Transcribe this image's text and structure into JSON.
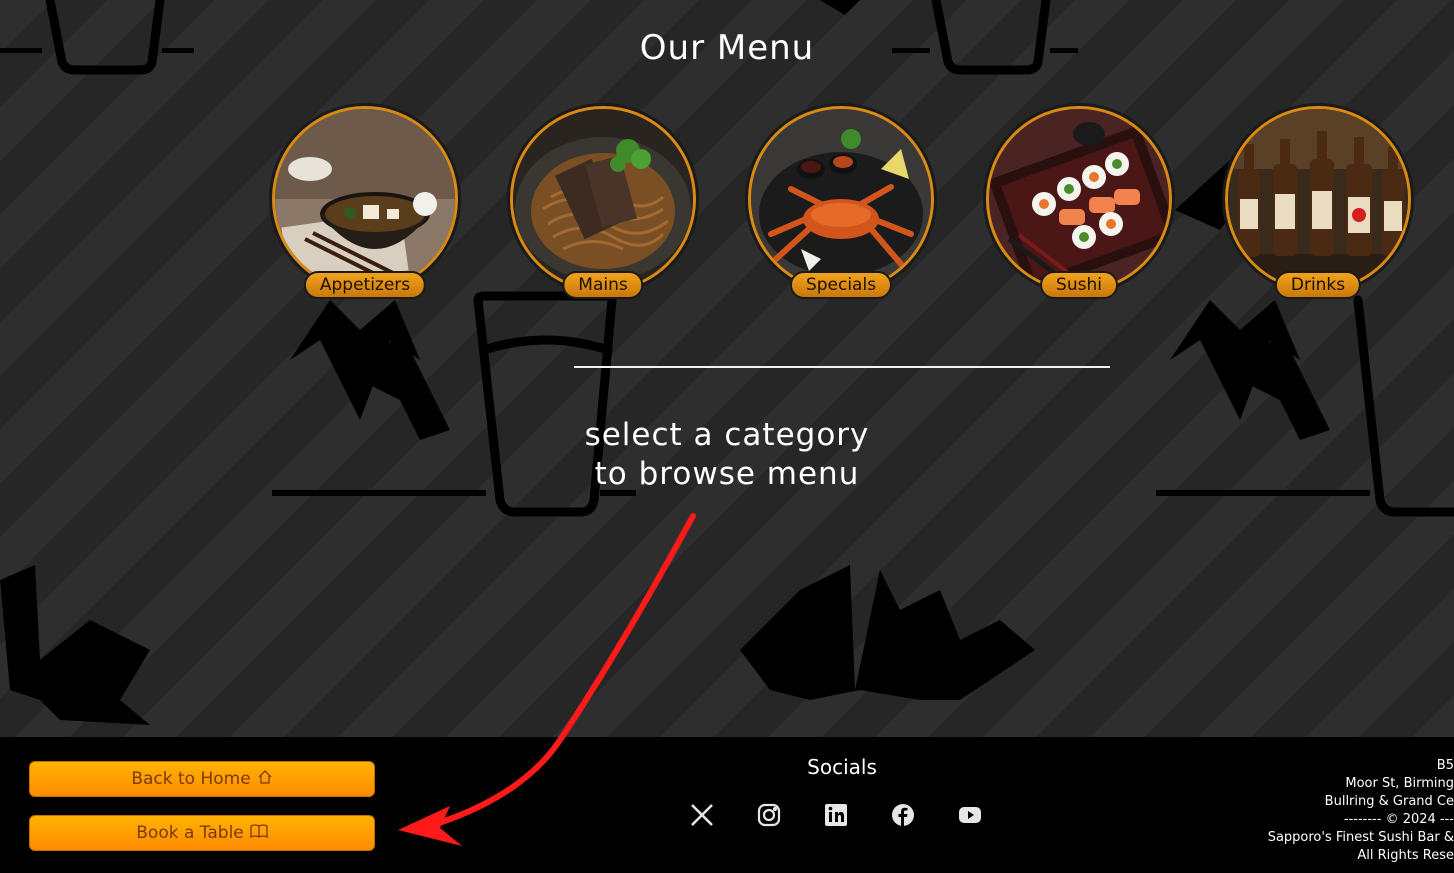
{
  "menu": {
    "title": "Our Menu",
    "categories": [
      {
        "label": "Appetizers"
      },
      {
        "label": "Mains"
      },
      {
        "label": "Specials"
      },
      {
        "label": "Sushi"
      },
      {
        "label": "Drinks"
      }
    ],
    "prompt_line1": "select a category",
    "prompt_line2": "to browse menu"
  },
  "footer": {
    "back_home": "Back to Home",
    "book_table": "Book a Table",
    "socials_title": "Socials",
    "social_icons": [
      "x-icon",
      "instagram-icon",
      "linkedin-icon",
      "facebook-icon",
      "youtube-icon"
    ],
    "address_lines": [
      "B5",
      "Moor St, Birming",
      "Bullring & Grand Ce",
      "-------- © 2024 ---",
      "Sapporo's Finest Sushi Bar &",
      "All Rights Rese"
    ]
  },
  "colors": {
    "accent": "#ff9a00",
    "pill": "#d98a12",
    "arrow": "#ff0000"
  }
}
